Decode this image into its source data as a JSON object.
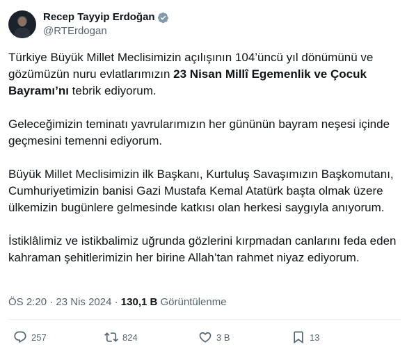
{
  "author": {
    "display_name": "Recep Tayyip Erdoğan",
    "handle": "@RTErdogan",
    "verified": true
  },
  "tweet": {
    "p1_before": "Türkiye Büyük Millet Meclisimizin açılışının 104’üncü yıl dönümünü ve gözümüzün nuru evlatlarımızın ",
    "p1_bold": "23 Nisan Millî Egemenlik ve Çocuk Bayramı’nı",
    "p1_after": " tebrik ediyorum.",
    "p2": "Geleceğimizin teminatı yavrularımızın her gününün bayram neşesi içinde geçmesini temenni ediyorum.",
    "p3": "Büyük Millet Meclisimizin ilk Başkanı, Kurtuluş Savaşımızın Başkomutanı, Cumhuriyetimizin banisi Gazi Mustafa Kemal Atatürk başta olmak üzere ülkemizin bugünlere gelmesinde katkısı olan herkesi saygıyla anıyorum.",
    "p4": "İstiklâlimiz ve istikbalimiz uğrunda gözlerini kırpmadan canlarını feda eden kahraman şehitlerimizin her birine Allah’tan rahmet niyaz ediyorum."
  },
  "meta": {
    "time": "ÖS 2:20",
    "separator": "·",
    "date": "23 Nis 2024",
    "views_count": "130,1 B",
    "views_label": "Görüntülenme"
  },
  "actions": {
    "replies": "257",
    "retweets": "824",
    "likes": "3 B",
    "bookmarks": "13"
  },
  "colors": {
    "text": "#0f1419",
    "secondary": "#536471",
    "verified_badge": "#829aab",
    "divider": "#eff3f4"
  },
  "icons": [
    "avatar",
    "verified-badge-icon",
    "reply-icon",
    "retweet-icon",
    "like-icon",
    "bookmark-icon"
  ]
}
